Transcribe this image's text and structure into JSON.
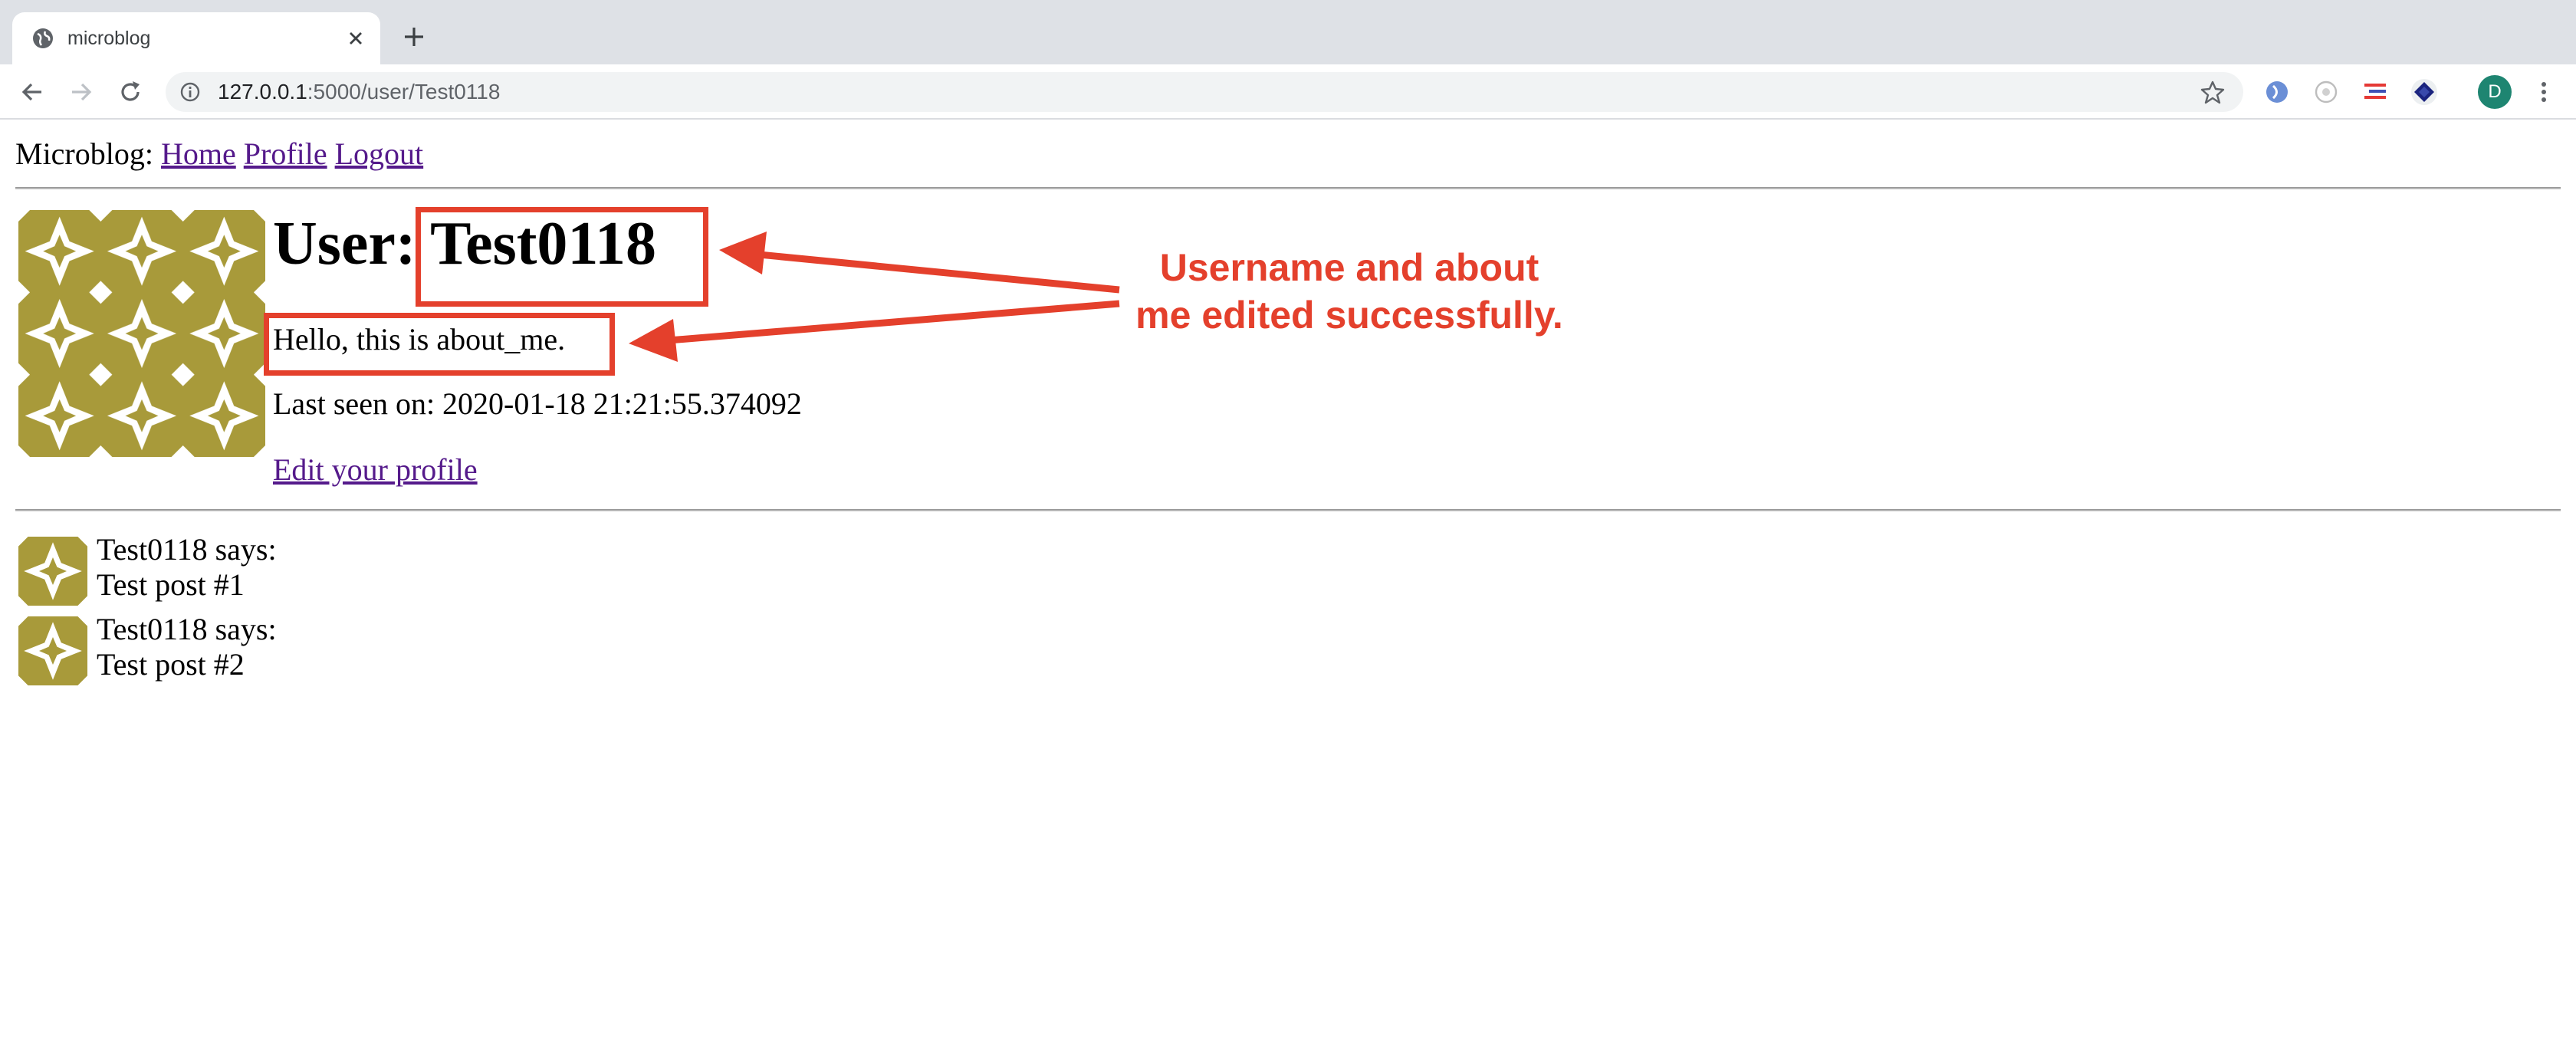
{
  "browser": {
    "tab_title": "microblog",
    "url_host": "127.0.0.1",
    "url_path": ":5000/user/Test0118",
    "profile_initial": "D"
  },
  "nav": {
    "brand": "Microblog:",
    "links": [
      "Home",
      "Profile",
      "Logout"
    ]
  },
  "user": {
    "heading_prefix": "User:",
    "username": "Test0118",
    "about_me": "Hello, this is about_me.",
    "last_seen": "Last seen on: 2020-01-18 21:21:55.374092",
    "edit_link": "Edit your profile"
  },
  "posts": [
    {
      "author_line": "Test0118 says:",
      "body": "Test post #1"
    },
    {
      "author_line": "Test0118 says:",
      "body": "Test post #2"
    }
  ],
  "annotation": {
    "callout_line1": "Username and about",
    "callout_line2": "me edited successfully.",
    "color": "#e4402c"
  },
  "icons": [
    "globe-icon",
    "close-icon",
    "plus-icon",
    "back-icon",
    "forward-icon",
    "reload-icon",
    "info-icon",
    "star-icon",
    "extension-icon",
    "menu-icon"
  ],
  "colors": {
    "identicon": "#a89a3a",
    "link": "#551a8b",
    "tabstrip": "#dee1e6",
    "profile_badge": "#1e8571"
  }
}
